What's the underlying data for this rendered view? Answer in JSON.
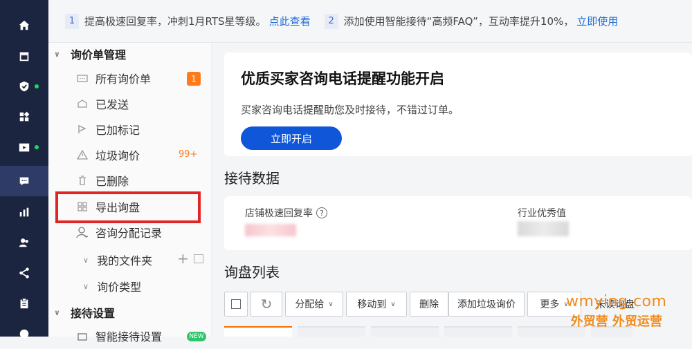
{
  "notice": {
    "n1": "1",
    "t1": "提高极速回复率，冲刺1月RTS星等级。",
    "l1": "点此查看",
    "n2": "2",
    "t2": "添加使用智能接待“高频FAQ”，互动率提升10%，",
    "l2": "立即使用"
  },
  "sidebar": {
    "group1": "询价单管理",
    "items": [
      {
        "label": "所有询价单",
        "icon": "inbox-icon"
      },
      {
        "label": "已发送",
        "icon": "sent-icon"
      },
      {
        "label": "已加标记",
        "icon": "flag-icon"
      },
      {
        "label": "垃圾询价",
        "icon": "warning-icon"
      },
      {
        "label": "已删除",
        "icon": "trash-icon"
      },
      {
        "label": "导出询盘",
        "icon": "grid-icon"
      },
      {
        "label": "咨询分配记录",
        "icon": "user-icon"
      }
    ],
    "badge_all": "1",
    "badge_spam": "99+",
    "subs": [
      "我的文件夹",
      "询价类型"
    ],
    "group2": "接待设置",
    "partial_item": "智能接待设置",
    "partial_badge": "NEW"
  },
  "banner": {
    "title": "优质买家咨询电话提醒功能开启",
    "desc": "买家咨询电话提醒助您及时接待，不错过订单。",
    "button": "立即开启"
  },
  "stats": {
    "title": "接待数据",
    "label1": "店铺极速回复率",
    "help": "?",
    "label2": "行业优秀值"
  },
  "inquiries": {
    "title": "询盘列表",
    "toolbar": [
      "分配给",
      "移动到",
      "删除",
      "添加垃圾询价",
      "更多",
      "未读询盘"
    ]
  },
  "watermark": {
    "line1": "wmying.com",
    "line2": "外贸营 外贸运营"
  },
  "colors": {
    "rail": "#1b2540",
    "accent_blue": "#0f56d9",
    "accent_orange": "#ff7a1a",
    "highlight_red": "#e32424"
  }
}
